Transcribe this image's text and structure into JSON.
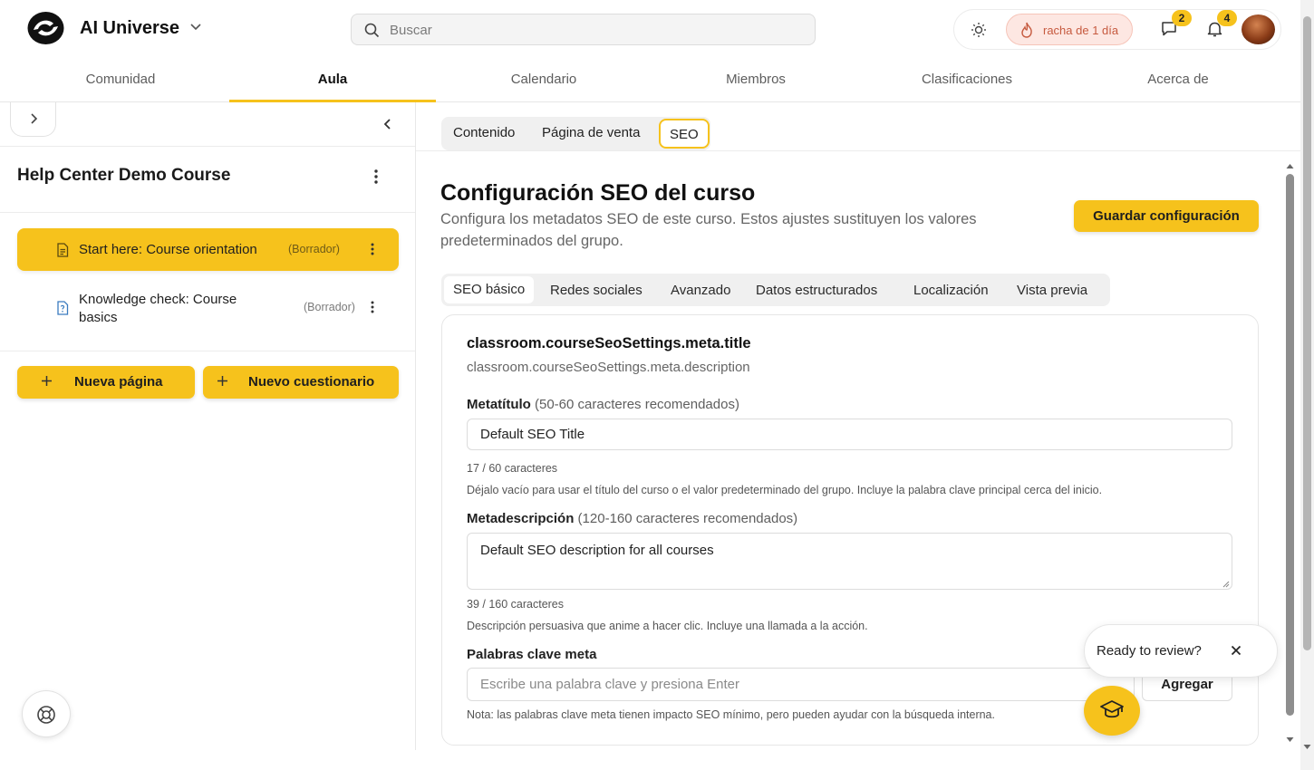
{
  "header": {
    "app_name": "AI Universe",
    "search_placeholder": "Buscar",
    "streak_label": "racha de 1 día",
    "messages_count": "2",
    "notifications_count": "4"
  },
  "nav": {
    "tabs": [
      {
        "label": "Comunidad",
        "active": false
      },
      {
        "label": "Aula",
        "active": true
      },
      {
        "label": "Calendario",
        "active": false
      },
      {
        "label": "Miembros",
        "active": false
      },
      {
        "label": "Clasificaciones",
        "active": false
      },
      {
        "label": "Acerca de",
        "active": false
      }
    ]
  },
  "sidebar": {
    "course_title": "Help Center Demo Course",
    "lessons": [
      {
        "title": "Start here: Course orientation",
        "status": "(Borrador)",
        "icon": "document-icon",
        "active": true
      },
      {
        "title": "Knowledge check: Course basics",
        "status": "(Borrador)",
        "icon": "quiz-icon",
        "active": false
      }
    ],
    "new_page_label": "Nueva página",
    "new_quiz_label": "Nuevo cuestionario"
  },
  "content_tabs": [
    "Contenido",
    "Página de venta",
    "SEO"
  ],
  "active_content_tab": "SEO",
  "main": {
    "title": "Configuración SEO del curso",
    "subtitle": "Configura los metadatos SEO de este curso. Estos ajustes sustituyen los valores predeterminados del grupo.",
    "save_label": "Guardar configuración"
  },
  "seo_tabs": [
    "SEO básico",
    "Redes sociales",
    "Avanzado",
    "Datos estructurados",
    "Localización",
    "Vista previa"
  ],
  "active_seo_tab": "SEO básico",
  "card": {
    "title": "classroom.courseSeoSettings.meta.title",
    "description": "classroom.courseSeoSettings.meta.description",
    "meta_title_label": "Metatítulo",
    "meta_title_hint": "(50-60 caracteres recomendados)",
    "meta_title_value": "Default SEO Title",
    "meta_title_count": "17 / 60 caracteres",
    "meta_title_help": "Déjalo vacío para usar el título del curso o el valor predeterminado del grupo. Incluye la palabra clave principal cerca del inicio.",
    "meta_desc_label": "Metadescripción",
    "meta_desc_hint": "(120-160 caracteres recomendados)",
    "meta_desc_value": "Default SEO description for all courses",
    "meta_desc_count": "39 / 160 caracteres",
    "meta_desc_help": "Descripción persuasiva que anime a hacer clic. Incluye una llamada a la acción.",
    "keywords_label": "Palabras clave meta",
    "keywords_placeholder": "Escribe una palabra clave y presiona Enter",
    "add_label": "Agregar",
    "keywords_note": "Nota: las palabras clave meta tienen impacto SEO mínimo, pero pueden ayudar con la búsqueda interna."
  },
  "toast": {
    "text": "Ready to review?"
  },
  "colors": {
    "accent": "#f6c21c",
    "streak_bg": "#fde7e2",
    "streak_text": "#c65a3f"
  }
}
